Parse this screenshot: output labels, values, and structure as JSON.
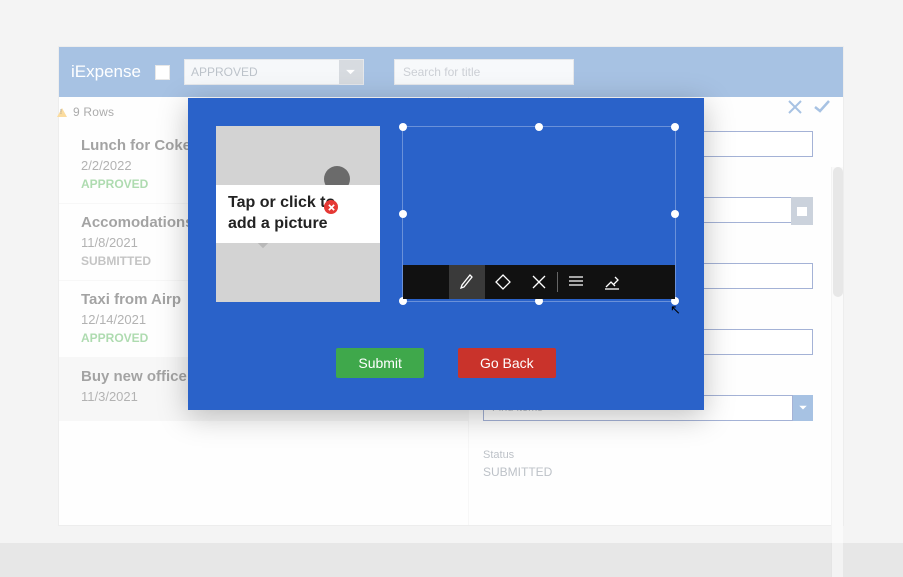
{
  "header": {
    "app_title": "iExpense",
    "status_filter": "APPROVED",
    "search_placeholder": "Search for title"
  },
  "rows_label": "9 Rows",
  "items": [
    {
      "title": "Lunch for Coke",
      "date": "2/2/2022",
      "status": "APPROVED"
    },
    {
      "title": "Accomodations",
      "date": "11/8/2021",
      "status": "SUBMITTED"
    },
    {
      "title": "Taxi from Airp",
      "date": "12/14/2021",
      "status": "APPROVED"
    },
    {
      "title": "Buy new office supplies for the team",
      "date": "11/3/2021",
      "status": ""
    }
  ],
  "right_panel": {
    "find_placeholder": "Find items",
    "status_label": "Status",
    "status_value": "SUBMITTED"
  },
  "modal": {
    "picture_label": "Tap or click to add a picture",
    "submit_label": "Submit",
    "goback_label": "Go Back",
    "toolbar_icons": [
      "pen-icon",
      "eraser-icon",
      "clear-icon",
      "lines-icon",
      "sign-icon"
    ]
  }
}
